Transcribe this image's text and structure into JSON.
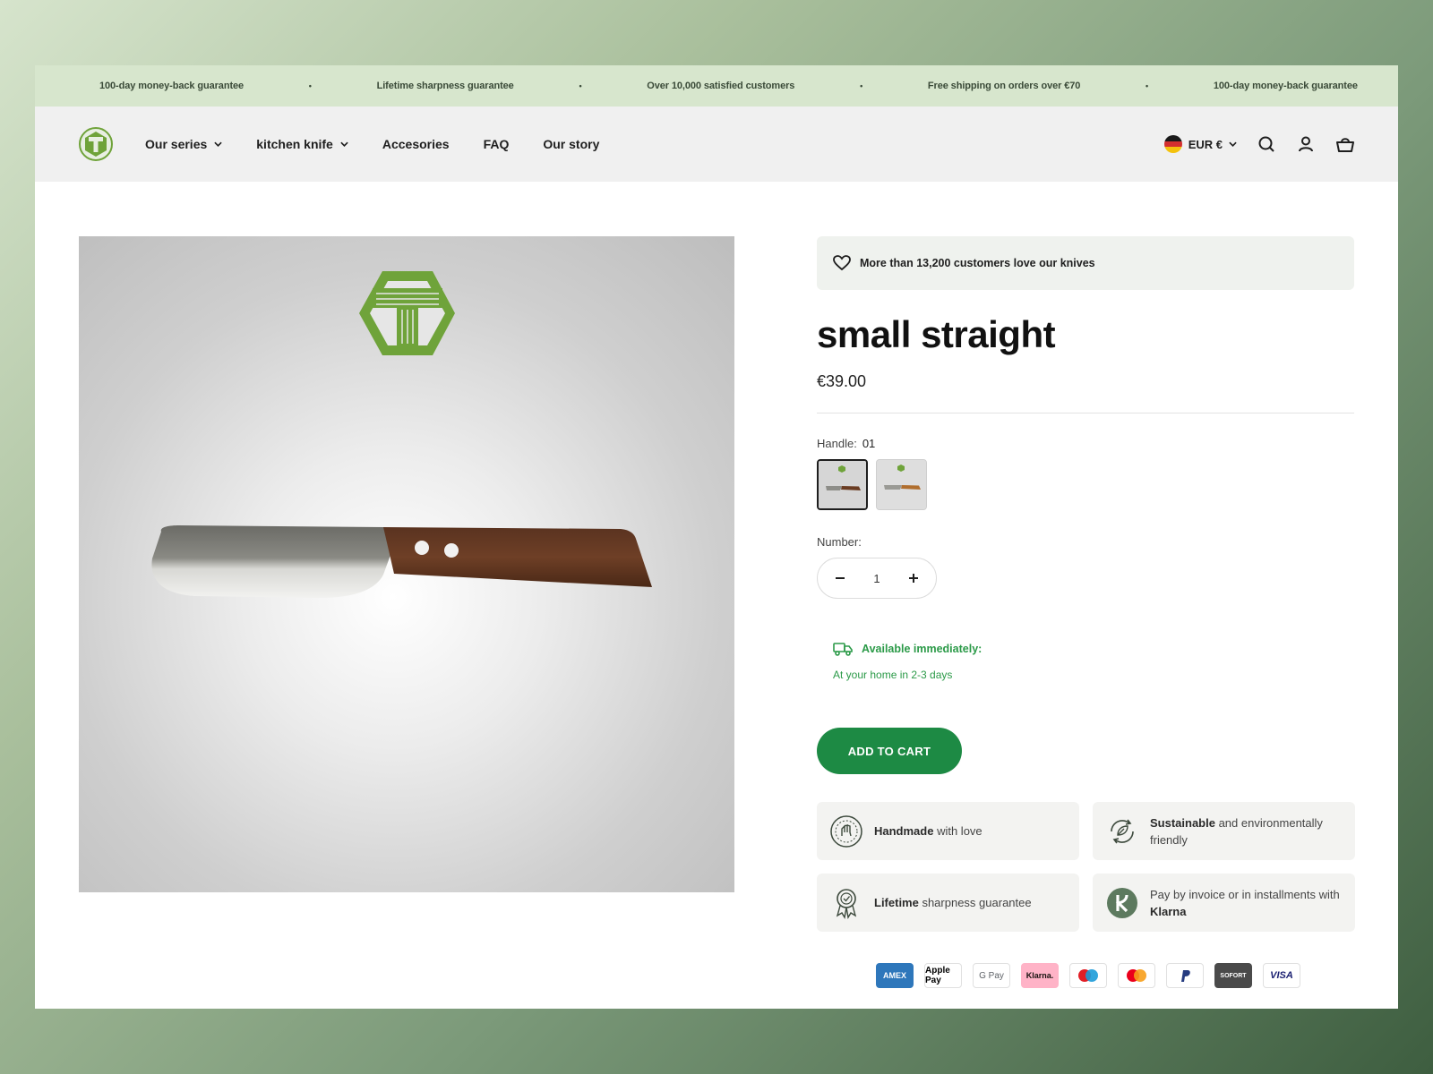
{
  "announcement": {
    "items": [
      "100-day money-back guarantee",
      "Lifetime sharpness guarantee",
      "Over 10,000 satisfied customers",
      "Free shipping on orders over €70",
      "100-day money-back guarantee"
    ],
    "separator": "•"
  },
  "header": {
    "nav": [
      {
        "label": "Our series",
        "has_dropdown": true
      },
      {
        "label": "kitchen knife",
        "has_dropdown": true
      },
      {
        "label": "Accesories",
        "has_dropdown": false
      },
      {
        "label": "FAQ",
        "has_dropdown": false
      },
      {
        "label": "Our story",
        "has_dropdown": false
      }
    ],
    "currency": "EUR €",
    "icons": [
      "search-icon",
      "account-icon",
      "cart-icon"
    ]
  },
  "product": {
    "love_text": "More than 13,200 customers love our knives",
    "title": "small straight",
    "price": "€39.00",
    "handle_label": "Handle:",
    "handle_value": "01",
    "number_label": "Number:",
    "quantity": "1",
    "availability_title": "Available immediately:",
    "availability_sub": "At your home in 2-3 days",
    "add_to_cart": "ADD TO CART"
  },
  "features": [
    {
      "bold": "Handmade",
      "rest": " with love",
      "icon": "handmade-icon"
    },
    {
      "bold": "Sustainable",
      "rest": " and environmentally friendly",
      "icon": "sustainable-icon"
    },
    {
      "bold": "Lifetime",
      "rest": " sharpness guarantee",
      "icon": "award-icon"
    },
    {
      "bold_prefix": "Pay by invoice or in installments with ",
      "bold": "Klarna",
      "icon": "klarna-icon"
    }
  ],
  "payments": [
    "AMEX",
    "Apple Pay",
    "G Pay",
    "Klarna.",
    "Maestro",
    "Mastercard",
    "PayPal",
    "SOFORT",
    "VISA"
  ],
  "colors": {
    "accent": "#1d8a44",
    "availability": "#2b9a48",
    "announcement_bg": "#d7e6cd",
    "logo_green": "#6fa33a"
  }
}
